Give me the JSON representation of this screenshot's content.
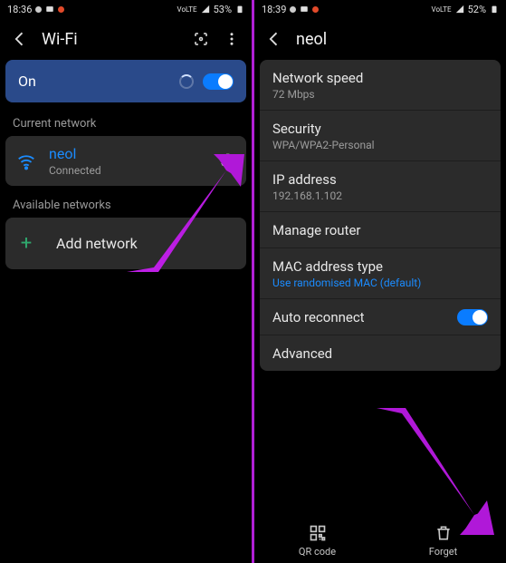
{
  "left": {
    "status": {
      "time": "18:36",
      "battery": "53%",
      "network_indicator": "VoLTE"
    },
    "header": {
      "title": "Wi-Fi"
    },
    "toggle": {
      "label": "On"
    },
    "current_label": "Current network",
    "current": {
      "name": "neol",
      "status": "Connected"
    },
    "available_label": "Available networks",
    "add_network_label": "Add network"
  },
  "right": {
    "status": {
      "time": "18:39",
      "battery": "52%",
      "network_indicator": "VoLTE"
    },
    "header": {
      "title": "neol"
    },
    "details": {
      "speed_title": "Network speed",
      "speed_value": "72 Mbps",
      "security_title": "Security",
      "security_value": "WPA/WPA2-Personal",
      "ip_title": "IP address",
      "ip_value": "192.168.1.102",
      "manage_router": "Manage router",
      "mac_title": "MAC address type",
      "mac_value": "Use randomised MAC (default)",
      "auto_reconnect": "Auto reconnect",
      "advanced": "Advanced"
    },
    "bottom": {
      "qr": "QR code",
      "forget": "Forget"
    }
  }
}
